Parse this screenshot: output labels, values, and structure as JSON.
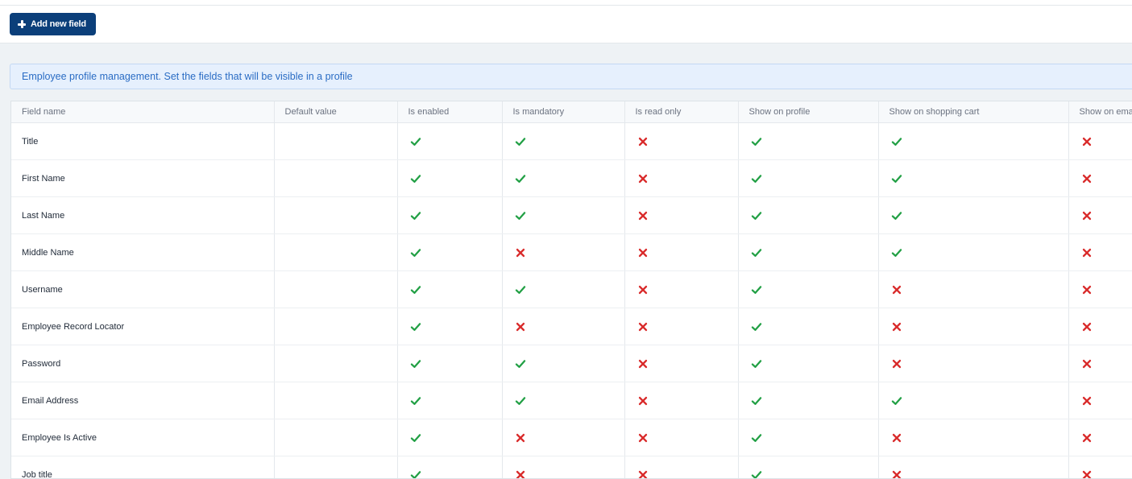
{
  "toolbar": {
    "add_button_label": "Add new field"
  },
  "banner": {
    "text": "Employee profile management. Set the fields that will be visible in a profile"
  },
  "table": {
    "columns": [
      "Field name",
      "Default value",
      "Is enabled",
      "Is mandatory",
      "Is read only",
      "Show on profile",
      "Show on shopping cart",
      "Show on ema"
    ],
    "rows": [
      {
        "name": "Title",
        "default_value": "",
        "flags": [
          true,
          true,
          false,
          true,
          true,
          false
        ]
      },
      {
        "name": "First Name",
        "default_value": "",
        "flags": [
          true,
          true,
          false,
          true,
          true,
          false
        ]
      },
      {
        "name": "Last Name",
        "default_value": "",
        "flags": [
          true,
          true,
          false,
          true,
          true,
          false
        ]
      },
      {
        "name": "Middle Name",
        "default_value": "",
        "flags": [
          true,
          false,
          false,
          true,
          true,
          false
        ]
      },
      {
        "name": "Username",
        "default_value": "",
        "flags": [
          true,
          true,
          false,
          true,
          false,
          false
        ]
      },
      {
        "name": "Employee Record Locator",
        "default_value": "",
        "flags": [
          true,
          false,
          false,
          true,
          false,
          false
        ]
      },
      {
        "name": "Password",
        "default_value": "",
        "flags": [
          true,
          true,
          false,
          true,
          false,
          false
        ]
      },
      {
        "name": "Email Address",
        "default_value": "",
        "flags": [
          true,
          true,
          false,
          true,
          true,
          false
        ]
      },
      {
        "name": "Employee Is Active",
        "default_value": "",
        "flags": [
          true,
          false,
          false,
          true,
          false,
          false
        ]
      },
      {
        "name": "Job title",
        "default_value": "",
        "flags": [
          true,
          false,
          false,
          true,
          false,
          false
        ]
      }
    ]
  },
  "colors": {
    "primary_button": "#0b3f7a",
    "check": "#22a045",
    "cross": "#d92b2b",
    "banner_text": "#2a6cc4"
  },
  "icons": {
    "true_flag": "check-icon",
    "false_flag": "cross-icon",
    "add": "plus-icon"
  }
}
